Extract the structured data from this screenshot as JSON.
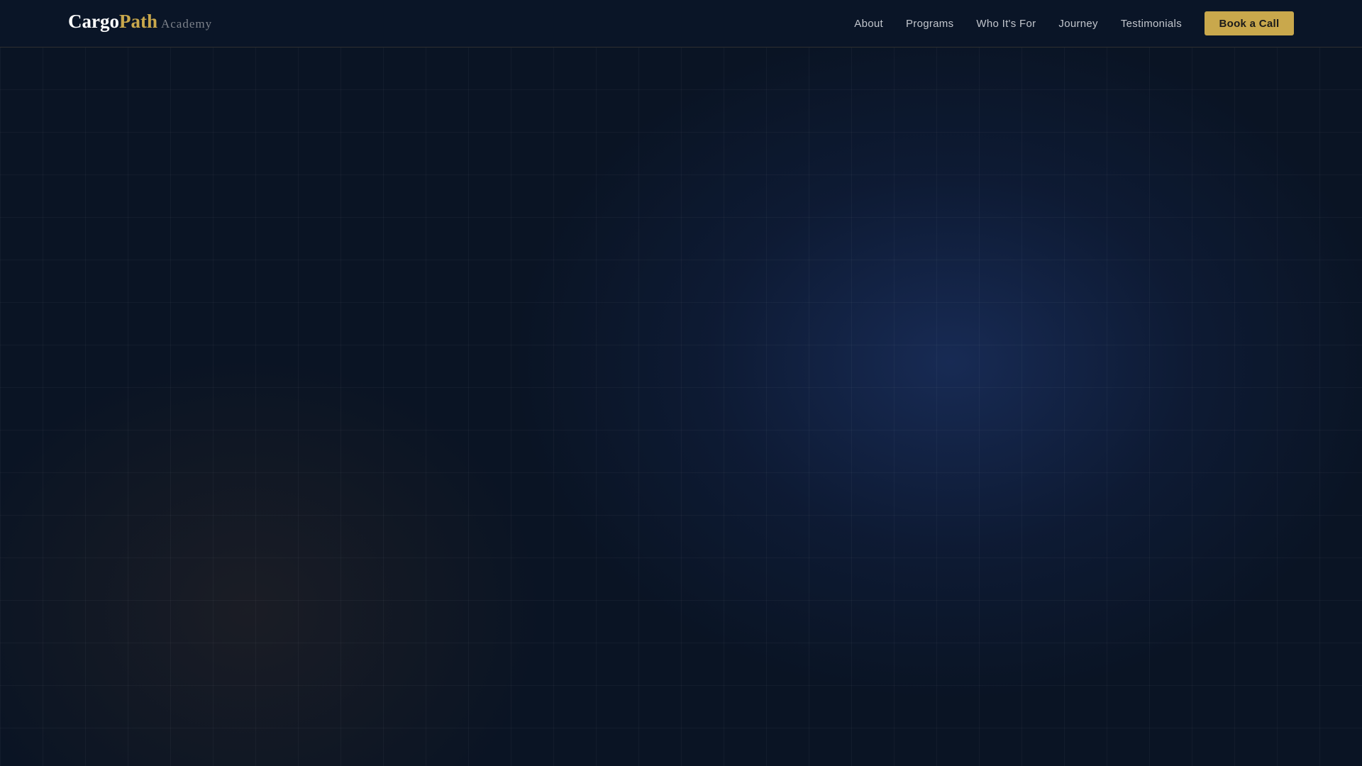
{
  "brand": {
    "part1": "Cargo",
    "part2": "Path",
    "sub": "Academy"
  },
  "nav": {
    "items": [
      "About",
      "Programs",
      "Who It's For",
      "Journey",
      "Testimonials"
    ],
    "cta": "Book a Call"
  },
  "colors": {
    "accent": "#c9a84c",
    "background": "#0a1424"
  }
}
